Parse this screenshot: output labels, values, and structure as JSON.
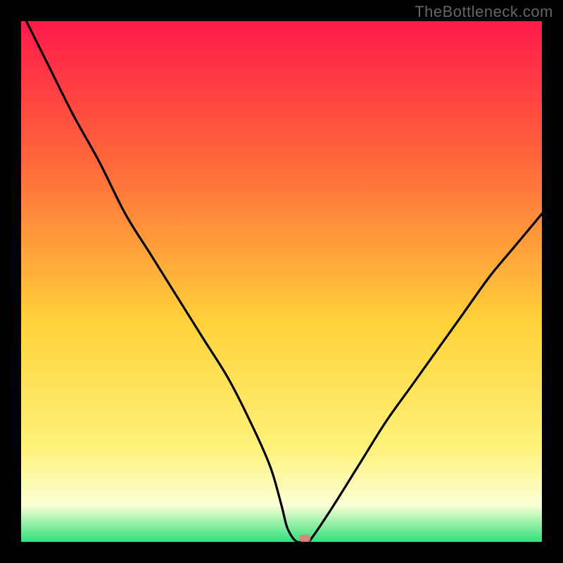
{
  "watermark": "TheBottleneck.com",
  "colors": {
    "frame_bg": "#000000",
    "gradient_top": "#ff1a4a",
    "gradient_mid_upper": "#ff6a3a",
    "gradient_mid": "#ffd23a",
    "gradient_mid_lower": "#fff27a",
    "gradient_lower": "#fbffd6",
    "gradient_bottom": "#2fe07a",
    "curve_stroke": "#000000",
    "marker_fill": "#e77d7a"
  },
  "chart_data": {
    "type": "line",
    "title": "",
    "xlabel": "",
    "ylabel": "",
    "xlim": [
      0,
      100
    ],
    "ylim": [
      0,
      100
    ],
    "grid": false,
    "legend": false,
    "series": [
      {
        "name": "bottleneck-curve",
        "x": [
          1,
          5,
          10,
          15,
          20,
          25,
          30,
          35,
          40,
          45,
          48,
          50,
          51,
          52,
          53,
          54,
          55,
          56,
          60,
          65,
          70,
          75,
          80,
          85,
          90,
          95,
          100
        ],
        "y": [
          100,
          92,
          82,
          73,
          63,
          55,
          47,
          39,
          31,
          21,
          14,
          7,
          3,
          1,
          0,
          0,
          0,
          1,
          7,
          15,
          23,
          30,
          37,
          44,
          51,
          57,
          63
        ]
      }
    ],
    "marker": {
      "x": 54.5,
      "y": 0.6
    },
    "annotations": []
  }
}
